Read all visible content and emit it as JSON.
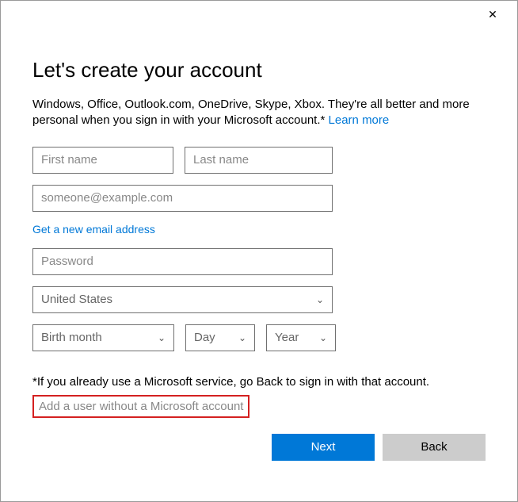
{
  "heading": "Let's create your account",
  "description_pre": "Windows, Office, Outlook.com, OneDrive, Skype, Xbox. They're all better and more personal when you sign in with your Microsoft account.* ",
  "learn_more": "Learn more",
  "fields": {
    "first_name_ph": "First name",
    "last_name_ph": "Last name",
    "email_ph": "someone@example.com",
    "new_email_link": "Get a new email address",
    "password_ph": "Password",
    "country_value": "United States",
    "birth_month": "Birth month",
    "day": "Day",
    "year": "Year"
  },
  "footnote": "*If you already use a Microsoft service, go Back to sign in with that account.",
  "add_user_link": "Add a user without a Microsoft account",
  "buttons": {
    "next": "Next",
    "back": "Back"
  }
}
